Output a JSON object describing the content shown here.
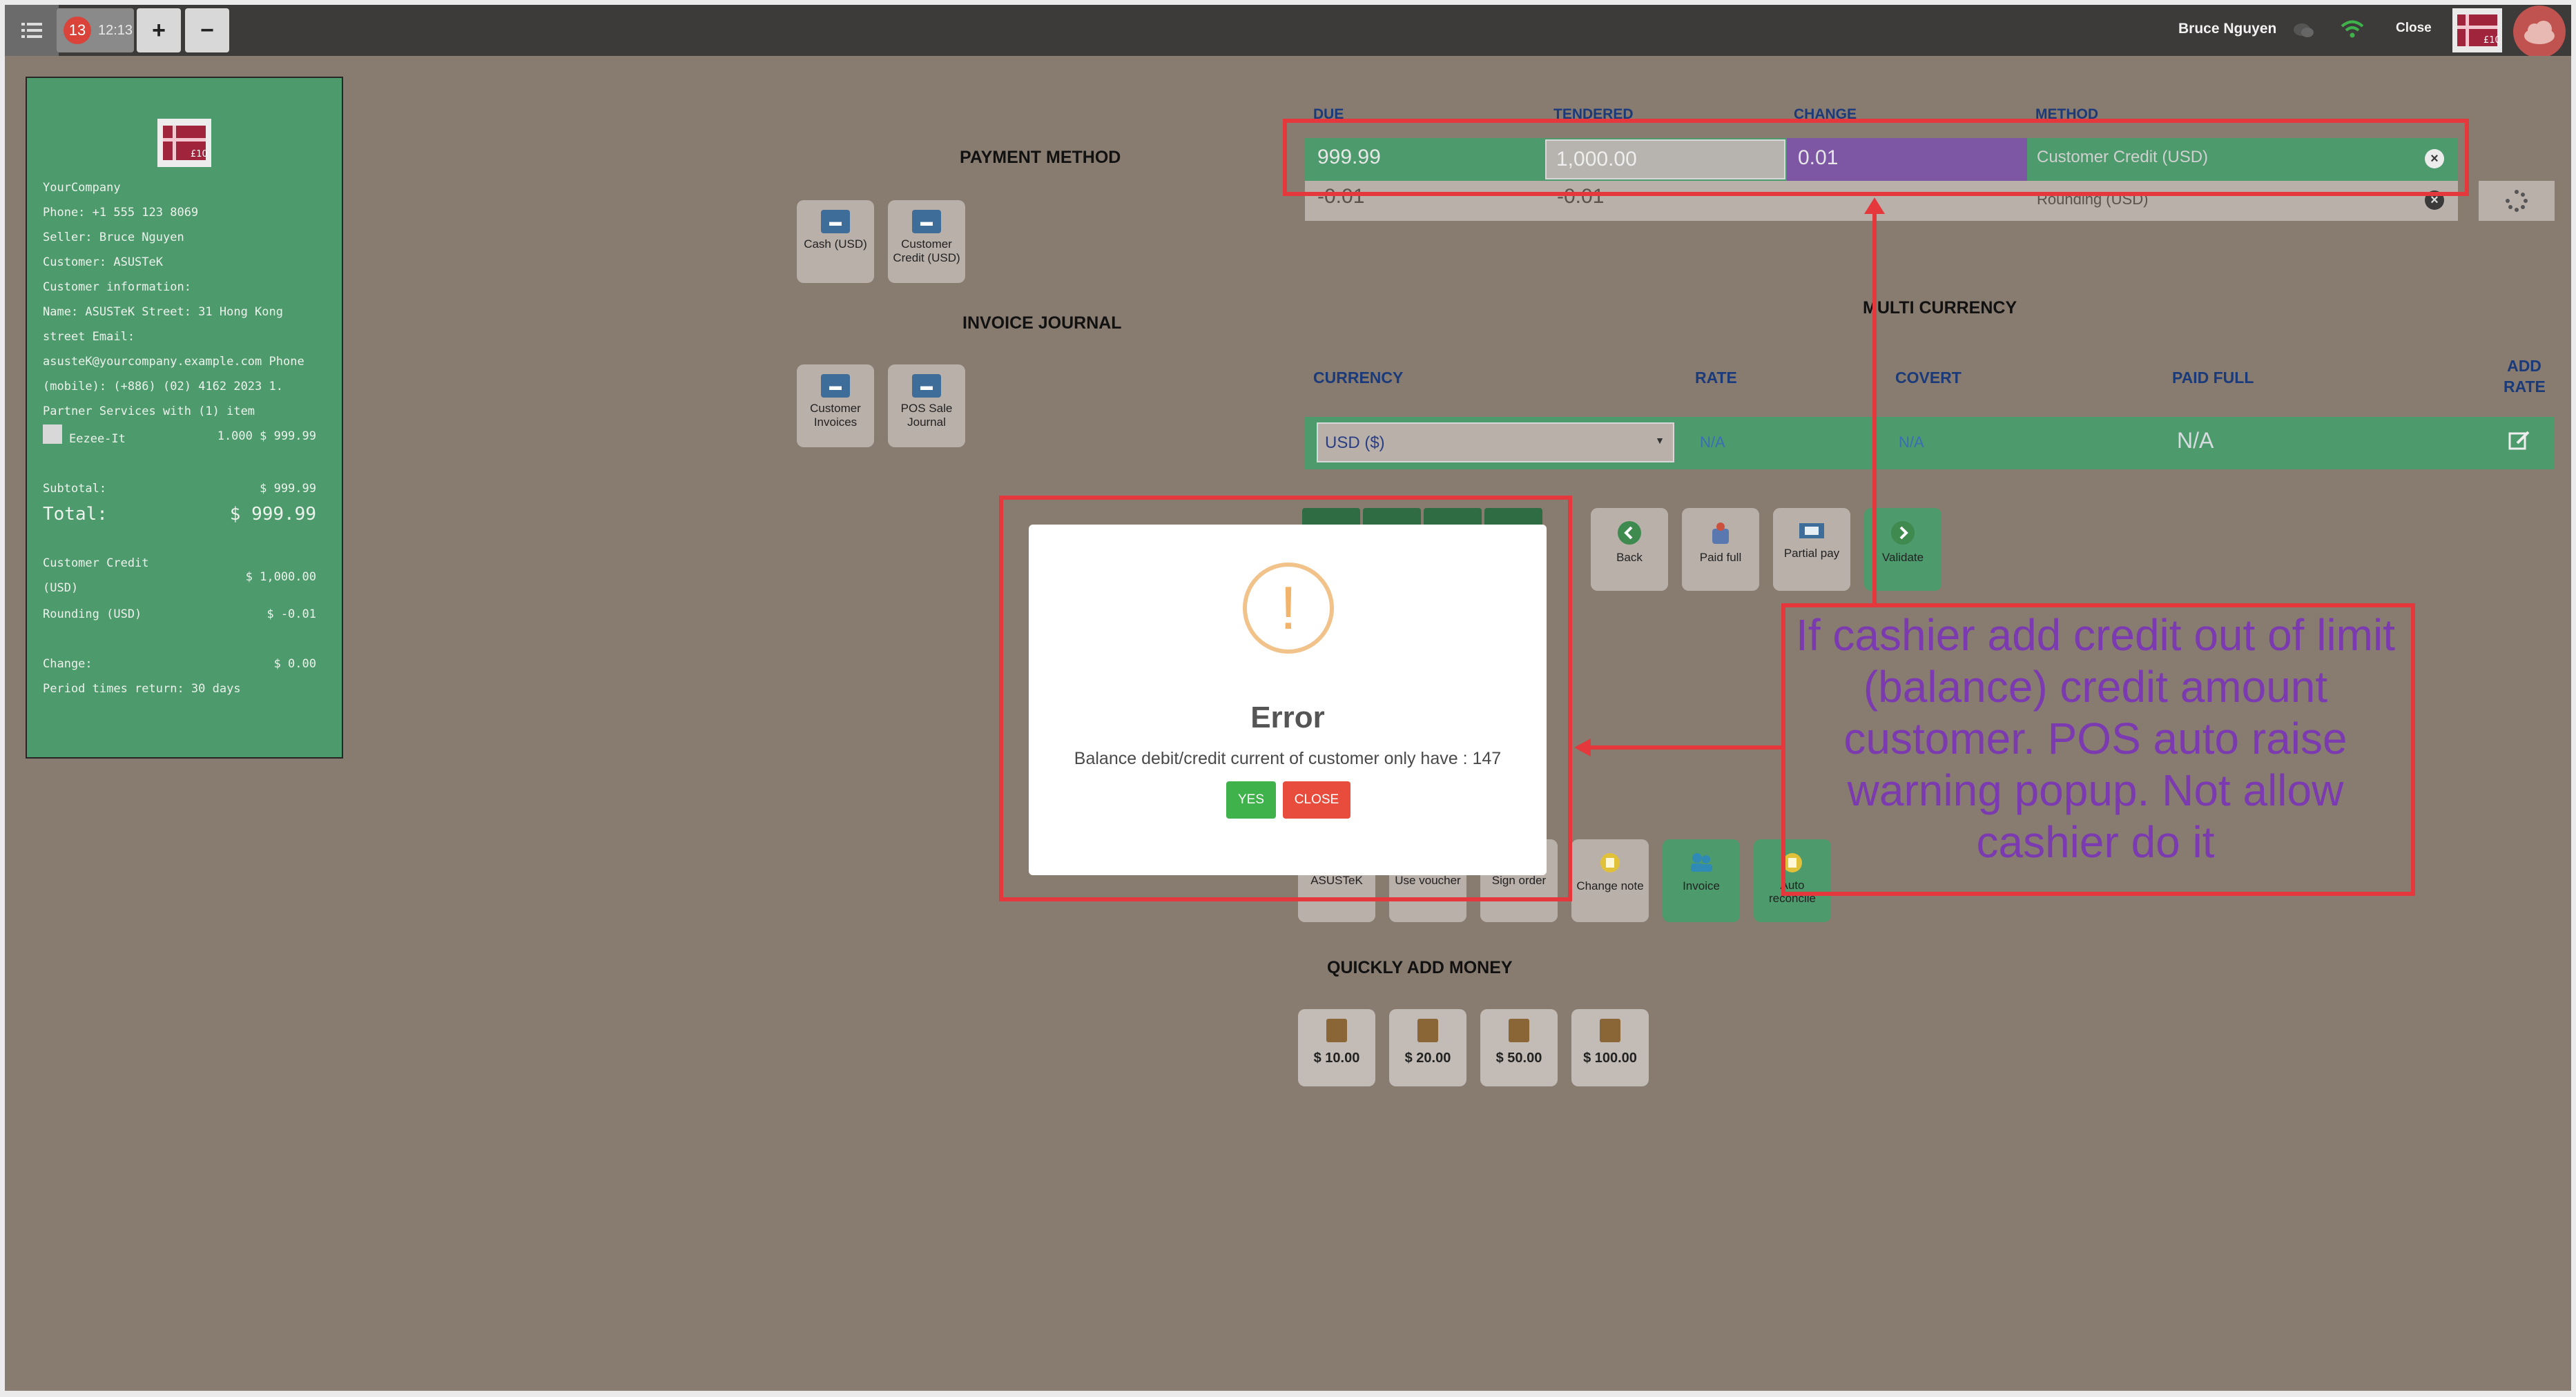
{
  "topbar": {
    "order_count": "13",
    "order_time": "12:13",
    "zoom_in": "+",
    "zoom_out": "−",
    "user": "Bruce Nguyen",
    "close": "Close"
  },
  "receipt": {
    "logo_text": "£10",
    "company": "YourCompany",
    "phone": "Phone: +1 555 123 8069",
    "seller": "Seller: Bruce Nguyen",
    "customer": "Customer: ASUSTeK",
    "customer_info": "Customer information:",
    "info_line1": "Name: ASUSTeK Street: 31 Hong Kong",
    "info_line2": "street Email:",
    "info_line3": "asusteK@yourcompany.example.com Phone",
    "info_line4": "(mobile): (+886) (02) 4162 2023 1.",
    "info_line5": "Partner Services with (1) item",
    "item_name": "Eezee-It",
    "item_qty_price": "1.000  $ 999.99",
    "subtotal_label": "Subtotal:",
    "subtotal_value": "$ 999.99",
    "total_label": "Total:",
    "total_value": "$ 999.99",
    "credit_label1": "Customer Credit",
    "credit_label2": "(USD)",
    "credit_value": "$ 1,000.00",
    "rounding_label": "Rounding (USD)",
    "rounding_value": "$ -0.01",
    "change_label": "Change:",
    "change_value": "$ 0.00",
    "period": "Period times return: 30 days"
  },
  "payment_method": {
    "title": "PAYMENT METHOD",
    "buttons": [
      "Cash (USD)",
      "Customer Credit (USD)"
    ]
  },
  "invoice_journal": {
    "title": "INVOICE JOURNAL",
    "buttons": [
      "Customer Invoices",
      "POS Sale Journal"
    ]
  },
  "payment_lines": {
    "headers": {
      "due": "DUE",
      "tendered": "TENDERED",
      "change": "CHANGE",
      "method": "METHOD"
    },
    "row1": {
      "due": "999.99",
      "tendered": "1,000.00",
      "change": "0.01",
      "method": "Customer Credit (USD)"
    },
    "row2": {
      "due": "-0.01",
      "tendered": "-0.01",
      "method": "Rounding (USD)"
    }
  },
  "multi_currency": {
    "title": "MULTI CURRENCY",
    "headers": {
      "currency": "CURRENCY",
      "rate": "RATE",
      "covert": "COVERT",
      "paid_full": "PAID FULL",
      "add_rate": "ADD RATE"
    },
    "selected": "USD ($)",
    "rate": "N/A",
    "covert": "N/A",
    "paid_full": "N/A"
  },
  "actions": {
    "back": "Back",
    "paid_full": "Paid full",
    "partial_pay": "Partial pay",
    "validate": "Validate",
    "customer": "ASUSTeK",
    "use_voucher": "Use voucher",
    "sign_order": "Sign order",
    "change_note": "Change note",
    "invoice": "Invoice",
    "auto_reconcile": "Auto reconcile"
  },
  "quick_money": {
    "title": "QUICKLY ADD MONEY",
    "amounts": [
      "$ 10.00",
      "$ 20.00",
      "$ 50.00",
      "$ 100.00"
    ]
  },
  "modal": {
    "icon": "!",
    "title": "Error",
    "message": "Balance debit/credit current of customer only have : 147",
    "yes": "YES",
    "close": "CLOSE"
  },
  "annotation": {
    "text": "If cashier add credit out of limit (balance) credit amount customer. POS auto raise warning popup. Not allow cashier do it",
    "color": "#e4383d",
    "text_color": "#7b3ab0"
  },
  "colors": {
    "accent_green": "#4d9a6c",
    "background": "#887b70",
    "topbar": "#3d3b3a",
    "change_purple": "#7e57a4"
  }
}
